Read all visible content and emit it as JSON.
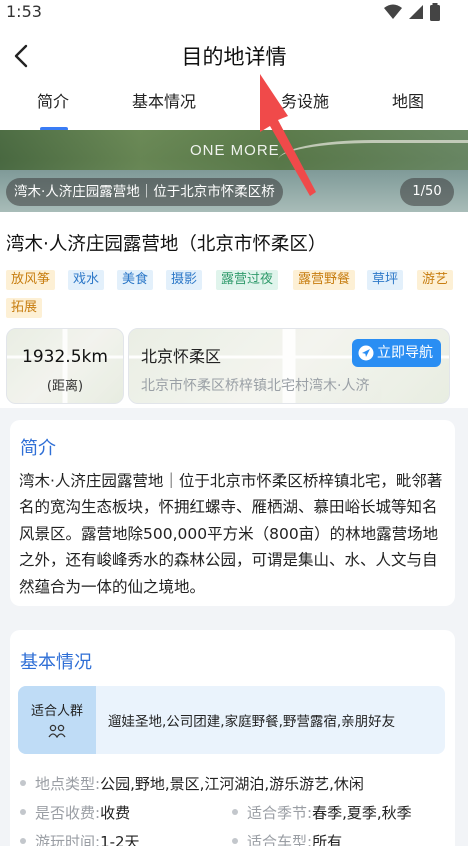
{
  "status_bar": {
    "time": "1:53"
  },
  "header": {
    "title": "目的地详情",
    "tabs": [
      {
        "label": "简介",
        "active": true
      },
      {
        "label": "基本情况",
        "active": false
      },
      {
        "label": "务设施",
        "active": false
      },
      {
        "label": "地图",
        "active": false
      }
    ]
  },
  "hero": {
    "watermark": "ONE MORE",
    "caption": "湾木·人济庄园露营地｜位于北京市怀柔区桥",
    "counter": "1/50"
  },
  "place": {
    "name": "湾木·人济庄园露营地（北京市怀柔区）",
    "tags": [
      {
        "label": "放风筝",
        "color": "orange"
      },
      {
        "label": "戏水",
        "color": "blue"
      },
      {
        "label": "美食",
        "color": "blue"
      },
      {
        "label": "摄影",
        "color": "blue"
      },
      {
        "label": "露营过夜",
        "color": "green"
      },
      {
        "label": "露营野餐",
        "color": "orange"
      },
      {
        "label": "草坪",
        "color": "blue"
      },
      {
        "label": "游艺",
        "color": "orange"
      },
      {
        "label": "拓展",
        "color": "orange"
      }
    ],
    "distance": {
      "value": "1932.5km",
      "label": "(距离)"
    },
    "address": {
      "title": "北京怀柔区",
      "detail": "北京市怀柔区桥梓镇北宅村湾木·人济",
      "nav_label": "立即导航"
    }
  },
  "intro": {
    "title": "简介",
    "text": "湾木·人济庄园露营地｜位于北京市怀柔区桥梓镇北宅，毗邻著名的宽沟生态板块，怀拥红螺寺、雁栖湖、慕田峪长城等知名风景区。露营地除500,000平方米（800亩）的林地露营场地之外，还有峻峰秀水的森林公园，可谓是集山、水、人文与自然蕴合为一体的仙之境地。"
  },
  "basic": {
    "title": "基本情况",
    "crowd_label": "适合人群",
    "crowd_value": "遛娃圣地,公司团建,家庭野餐,野营露宿,亲朋好友",
    "attributes": {
      "type": {
        "key": "地点类型:",
        "value": "公园,野地,景区,江河湖泊,游乐游艺,休闲"
      },
      "fee": {
        "key": "是否收费:",
        "value": "收费"
      },
      "season": {
        "key": "适合季节:",
        "value": "春季,夏季,秋季"
      },
      "duration": {
        "key": "游玩时间:",
        "value": "1-2天"
      },
      "vehicle": {
        "key": "适合车型:",
        "value": "所有"
      }
    }
  },
  "colors": {
    "accent": "#3a7cf5",
    "nav_button": "#2a8ef3",
    "annotation_arrow": "#f04a4a"
  }
}
